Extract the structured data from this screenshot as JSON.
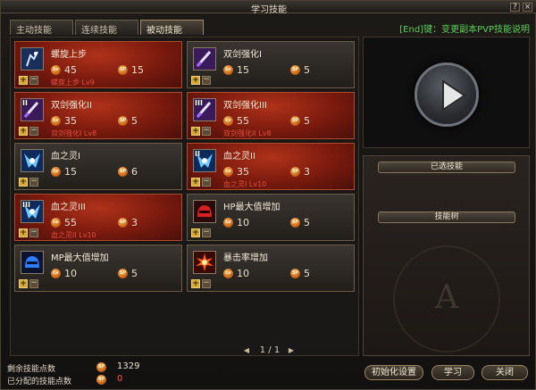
{
  "window": {
    "title": "学习技能",
    "help_button": "?",
    "close_button": "×"
  },
  "tabs": [
    {
      "label": "主动技能",
      "active": false
    },
    {
      "label": "连续技能",
      "active": false
    },
    {
      "label": "被动技能",
      "active": true
    }
  ],
  "help_text": "[End]键：变更副本PVP技能说明",
  "skills": [
    {
      "name": "螺旋上步",
      "level_req": "45",
      "sp_cost": "15",
      "requirement": "螺旋上步 Lv9",
      "learned": true,
      "icon": "spiral-step-icon"
    },
    {
      "name": "双剑强化I",
      "level_req": "15",
      "sp_cost": "5",
      "requirement": "",
      "learned": false,
      "icon": "twin-sword-icon"
    },
    {
      "name": "双剑强化II",
      "level_req": "35",
      "sp_cost": "5",
      "requirement": "双剑强化I Lv8",
      "learned": true,
      "icon": "twin-sword-icon"
    },
    {
      "name": "双剑强化III",
      "level_req": "55",
      "sp_cost": "5",
      "requirement": "双剑强化II Lv8",
      "learned": true,
      "icon": "twin-sword-icon"
    },
    {
      "name": "血之灵I",
      "level_req": "15",
      "sp_cost": "6",
      "requirement": "",
      "learned": false,
      "icon": "blood-spirit-icon"
    },
    {
      "name": "血之灵II",
      "level_req": "35",
      "sp_cost": "3",
      "requirement": "血之灵I Lv10",
      "learned": true,
      "icon": "blood-spirit-icon"
    },
    {
      "name": "血之灵III",
      "level_req": "55",
      "sp_cost": "3",
      "requirement": "血之灵II Lv10",
      "learned": true,
      "icon": "blood-spirit-icon"
    },
    {
      "name": "HP最大值增加",
      "level_req": "10",
      "sp_cost": "5",
      "requirement": "",
      "learned": false,
      "icon": "hp-helmet-icon"
    },
    {
      "name": "MP最大值增加",
      "level_req": "10",
      "sp_cost": "5",
      "requirement": "",
      "learned": false,
      "icon": "mp-helmet-icon"
    },
    {
      "name": "暴击率增加",
      "level_req": "10",
      "sp_cost": "5",
      "requirement": "",
      "learned": false,
      "icon": "critical-burst-icon"
    }
  ],
  "badges": {
    "level": "Lv",
    "sp": "SP"
  },
  "pager": {
    "text": "1 / 1",
    "prev": "◀",
    "next": "▶"
  },
  "side_panel": {
    "selected_skills": "已选技能",
    "skill_tree": "技能树",
    "emblem_letter": "A"
  },
  "footer": {
    "remaining_label": "剩余技能点数",
    "remaining_value": "1329",
    "allocated_label": "已分配的技能点数",
    "allocated_value": "0"
  },
  "buttons": {
    "reset": "初始化设置",
    "learn": "学习",
    "close": "关闭"
  },
  "colors": {
    "learned_card": "#9a2814",
    "normal_card": "#2e2a25",
    "help_text": "#5cd05a",
    "remaining": "#e8dfcf",
    "allocated": "#ff4a3a"
  }
}
